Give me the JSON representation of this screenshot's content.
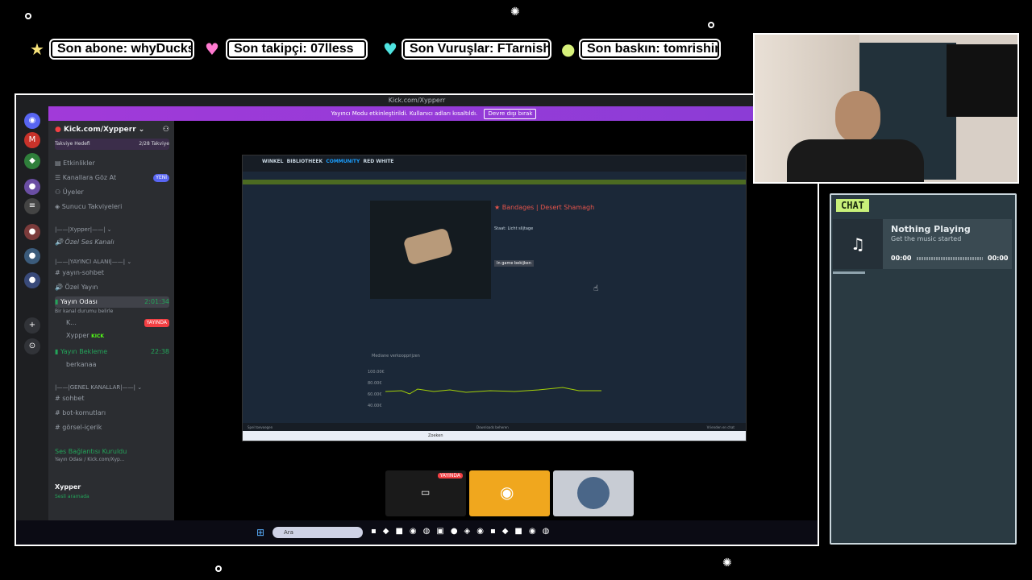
{
  "alerts": [
    {
      "label": "Son abone: whyDucks",
      "icon": "star-icon",
      "color": "#f6e27a"
    },
    {
      "label": "Son takipçi: 07lless",
      "icon": "heart-icon",
      "color": "#ff7ad0"
    },
    {
      "label": "Son Vuruşlar: FTarnished",
      "icon": "gem-icon",
      "color": "#4fe3e0"
    },
    {
      "label": "Son baskın: tomrishim",
      "icon": "orb-icon",
      "color": "#d6f07a"
    }
  ],
  "discord": {
    "title": "Kick.com/Xypperr",
    "banner_text": "Yayıncı Modu etkinleştirildi. Kullanıcı adları kısaltıldı.",
    "banner_button": "Devre dışı bırak",
    "server_name": "Kick.com/Xypperr",
    "boost_goal_label": "Takviye Hedefi",
    "boost_goal_value": "2/28 Takviye",
    "menu": [
      "Etkinlikler",
      "Kanallara Göz At",
      "Üyeler",
      "Sunucu Takviyeleri"
    ],
    "menu_badge": "YENİ",
    "cat1": "|——|Xypper|——|",
    "private_voice": "Özel Ses Kanalı",
    "cat2": "|——|YAYINCI ALANI|——|",
    "channels_a": [
      "yayın-sohbet",
      "Özel Yayın"
    ],
    "stream_room": "Yayın Odası",
    "stream_room_time": "2:01:34",
    "stream_room_desc": "Bir kanal durumu belirle",
    "user_k": "K...",
    "live_badge": "YAYINDA",
    "user_xypper": "Xypper",
    "kick_label": "KICK",
    "waiting_room": "Yayın Bekleme",
    "waiting_time": "22:38",
    "user_berkanaa": "berkanaa",
    "cat3": "|——|GENEL KANALLAR|——|",
    "channels_b": [
      "sohbet",
      "bot-komutları",
      "görsel-içerik"
    ],
    "voice_connected": "Ses Bağlantısı Kuruldu",
    "voice_sub": "Yayın Odası / Kick.com/Xyp...",
    "self_name": "Xypper",
    "self_status": "Sesli aramada"
  },
  "steam": {
    "nav": [
      "WINKEL",
      "BIBLIOTHEEK",
      "COMMUNITY",
      "RED WHITE"
    ],
    "active_nav": "COMMUNITY",
    "item_title": "★ Bandages | Desert Shamagh",
    "item_desc": "Staat: Licht slijtage",
    "game_button": "In game bekijken",
    "chart_label": "Mediane verkoopprijzen",
    "yticks": [
      "100.00€",
      "80.00€",
      "60.00€",
      "40.00€"
    ],
    "footer_left": "Spel toevoegen",
    "footer_mid": "Downloads beheren",
    "footer_right": "Vrienden en chat",
    "win_search": "Zoeken"
  },
  "tiles": {
    "live": "YAYINDA"
  },
  "taskbar": {
    "search": "Ara"
  },
  "chat": {
    "label": "CHAT",
    "now_playing": "Nothing Playing",
    "now_sub": "Get the music started",
    "time_start": "00:00",
    "time_end": "00:00"
  }
}
